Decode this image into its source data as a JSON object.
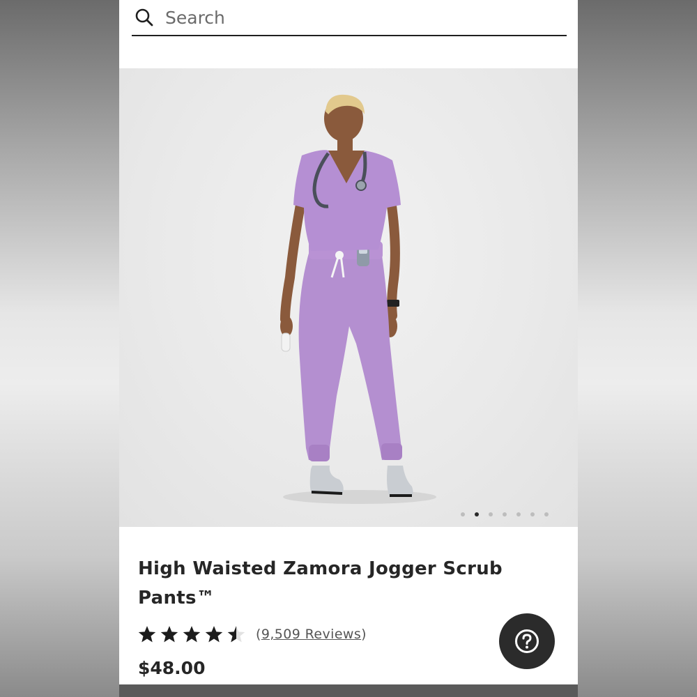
{
  "search": {
    "placeholder": "Search",
    "icon": "search-icon"
  },
  "hero": {
    "image_subject": "model wearing lavender scrub top and jogger pants",
    "carousel": {
      "total_slides": 7,
      "active_index": 1
    }
  },
  "product": {
    "title": "High Waisted Zamora Jogger Scrub Pants™",
    "rating": {
      "value": 4.5,
      "max": 5
    },
    "reviews_prefix": "(",
    "reviews_label": "9,509 Reviews",
    "reviews_suffix": ")",
    "price": "$48.00"
  },
  "help": {
    "icon": "question-icon"
  },
  "colors": {
    "scrub_lavender": "#b48fd0",
    "text_dark": "#262626",
    "help_button": "#2b2b2b"
  }
}
